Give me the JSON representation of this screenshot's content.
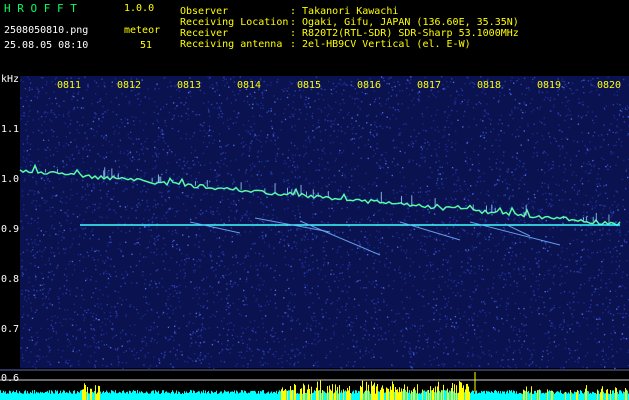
{
  "header": {
    "app_title": "H R O F F T",
    "app_version": "1.0.0",
    "file_name": "2508050810.png",
    "datetime": "25.08.05 08:10",
    "meteor_label": "meteor",
    "meteor_count": "51",
    "info": [
      {
        "label": "Observer",
        "value": ": Takanori Kawachi"
      },
      {
        "label": "Receiving Location",
        "value": ": Ogaki, Gifu, JAPAN (136.60E, 35.35N)"
      },
      {
        "label": "Receiver",
        "value": ": R820T2(RTL-SDR) SDR-Sharp 53.1000MHz"
      },
      {
        "label": "Receiving antenna",
        "value": ": 2el-HB9CV Vertical (el. E-W)"
      }
    ]
  },
  "y_axis": {
    "unit": "kHz",
    "ticks": [
      "1.1",
      "1.0",
      "0.9",
      "0.8",
      "0.7",
      "0.6"
    ]
  },
  "x_axis": {
    "ticks": [
      "0811",
      "0812",
      "0813",
      "0814",
      "0815",
      "0816",
      "0817",
      "0818",
      "0819",
      "0820"
    ]
  },
  "colors": {
    "background": "#000000",
    "noise": "#1a2a8a",
    "signal_cyan": "#00ffff",
    "signal_yellow": "#ffff00",
    "title_green": "#00ff66",
    "header_yellow": "#ffff00"
  }
}
